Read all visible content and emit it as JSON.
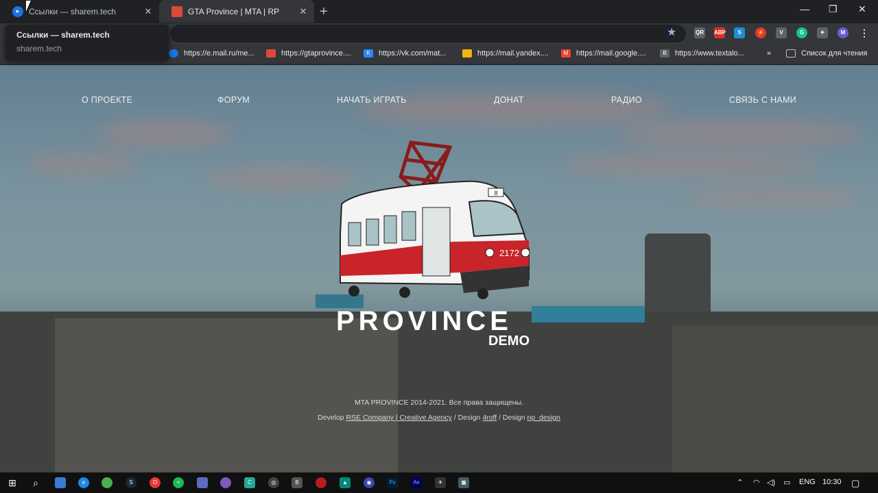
{
  "tabs": [
    {
      "title": "Ссылки — sharem.tech",
      "favicon_color": "#1a73e8",
      "active": false
    },
    {
      "title": "GTA Province | MTA | RP",
      "favicon_color": "#d84a3a",
      "active": true
    }
  ],
  "new_tab_label": "+",
  "window_controls": [
    "—",
    "❐",
    "✕"
  ],
  "tooltip": {
    "title": "Ссылки — sharem.tech",
    "url": "sharem.tech"
  },
  "extensions": [
    {
      "name": "qr-code-icon",
      "color": "#5f6368",
      "label": "QR"
    },
    {
      "name": "adblock-icon",
      "color": "#d93025",
      "label": "ABP"
    },
    {
      "name": "skype-icon",
      "color": "#1a8fd8",
      "label": "S"
    },
    {
      "name": "bolt-icon",
      "color": "#e53935",
      "label": "⚡"
    },
    {
      "name": "shield-icon",
      "color": "#5f6368",
      "label": "V"
    },
    {
      "name": "grammarly-icon",
      "color": "#15c39a",
      "label": "G"
    },
    {
      "name": "puzzle-icon",
      "color": "#5f6368",
      "label": "✦"
    },
    {
      "name": "profile-icon",
      "color": "#6b5bd6",
      "label": "M"
    }
  ],
  "bookmarks": [
    {
      "label": "https://e.mail.ru/me...",
      "color": "#1a73e8"
    },
    {
      "label": "https://gtaprovince....",
      "color": "#d84a3a"
    },
    {
      "label": "https://vk.com/mat...",
      "color": "#2787f5"
    },
    {
      "label": "https://mail.yandex....",
      "color": "#f2b40f"
    },
    {
      "label": "https://mail.google....",
      "color": "#ea4335"
    },
    {
      "label": "https://www.textalo...",
      "color": "#5f6368"
    }
  ],
  "bookmarks_more": "»",
  "reading_list": "Список для чтения",
  "nav": [
    "О ПРОЕКТЕ",
    "ФОРУМ",
    "НАЧАТЬ ИГРАТЬ",
    "ДОНАТ",
    "РАДИО",
    "СВЯЗЬ С НАМИ"
  ],
  "logo": {
    "title": "PROVINCE",
    "subtitle": "DEMO",
    "tram_number": "2172",
    "route": "8"
  },
  "footer": {
    "copyright": "MTA PROVINCE 2014-2021. Все права защищены.",
    "develop_prefix": "Develop",
    "develop_link": "RSE Company | Creative Agency",
    "design_prefix": "/ Design",
    "design_link": "4roff",
    "design2_prefix": "/ Design",
    "design2_link": "np_design"
  },
  "taskbar": {
    "apps": [
      {
        "name": "search-icon",
        "color": "transparent",
        "label": "⌕"
      },
      {
        "name": "explorer-icon",
        "color": "#3a7bd5",
        "label": ""
      },
      {
        "name": "edge-icon",
        "color": "#1e88e5",
        "label": "e"
      },
      {
        "name": "chrome-icon",
        "color": "#4caf50",
        "label": "●"
      },
      {
        "name": "steam-icon",
        "color": "#1b2838",
        "label": "S"
      },
      {
        "name": "opera-icon",
        "color": "#e53935",
        "label": "O"
      },
      {
        "name": "spotify-icon",
        "color": "#1db954",
        "label": "≈"
      },
      {
        "name": "app-icon",
        "color": "#5c6bc0",
        "label": ""
      },
      {
        "name": "tor-icon",
        "color": "#7e57c2",
        "label": ""
      },
      {
        "name": "app2-icon",
        "color": "#26a69a",
        "label": "C"
      },
      {
        "name": "obs-icon",
        "color": "#444",
        "label": "◎"
      },
      {
        "name": "app3-icon",
        "color": "#555",
        "label": "B"
      },
      {
        "name": "app4-icon",
        "color": "#b71c1c",
        "label": ""
      },
      {
        "name": "app5-icon",
        "color": "#00897b",
        "label": "▲"
      },
      {
        "name": "app6-icon",
        "color": "#3949ab",
        "label": "◉"
      },
      {
        "name": "photoshop-icon",
        "color": "#001e36",
        "label": "Ps"
      },
      {
        "name": "aftereffects-icon",
        "color": "#00005b",
        "label": "Ae"
      },
      {
        "name": "app7-icon",
        "color": "#333",
        "label": "✈"
      },
      {
        "name": "calculator-icon",
        "color": "#455a64",
        "label": "▦"
      }
    ],
    "language": "ENG",
    "time": "10:30"
  }
}
